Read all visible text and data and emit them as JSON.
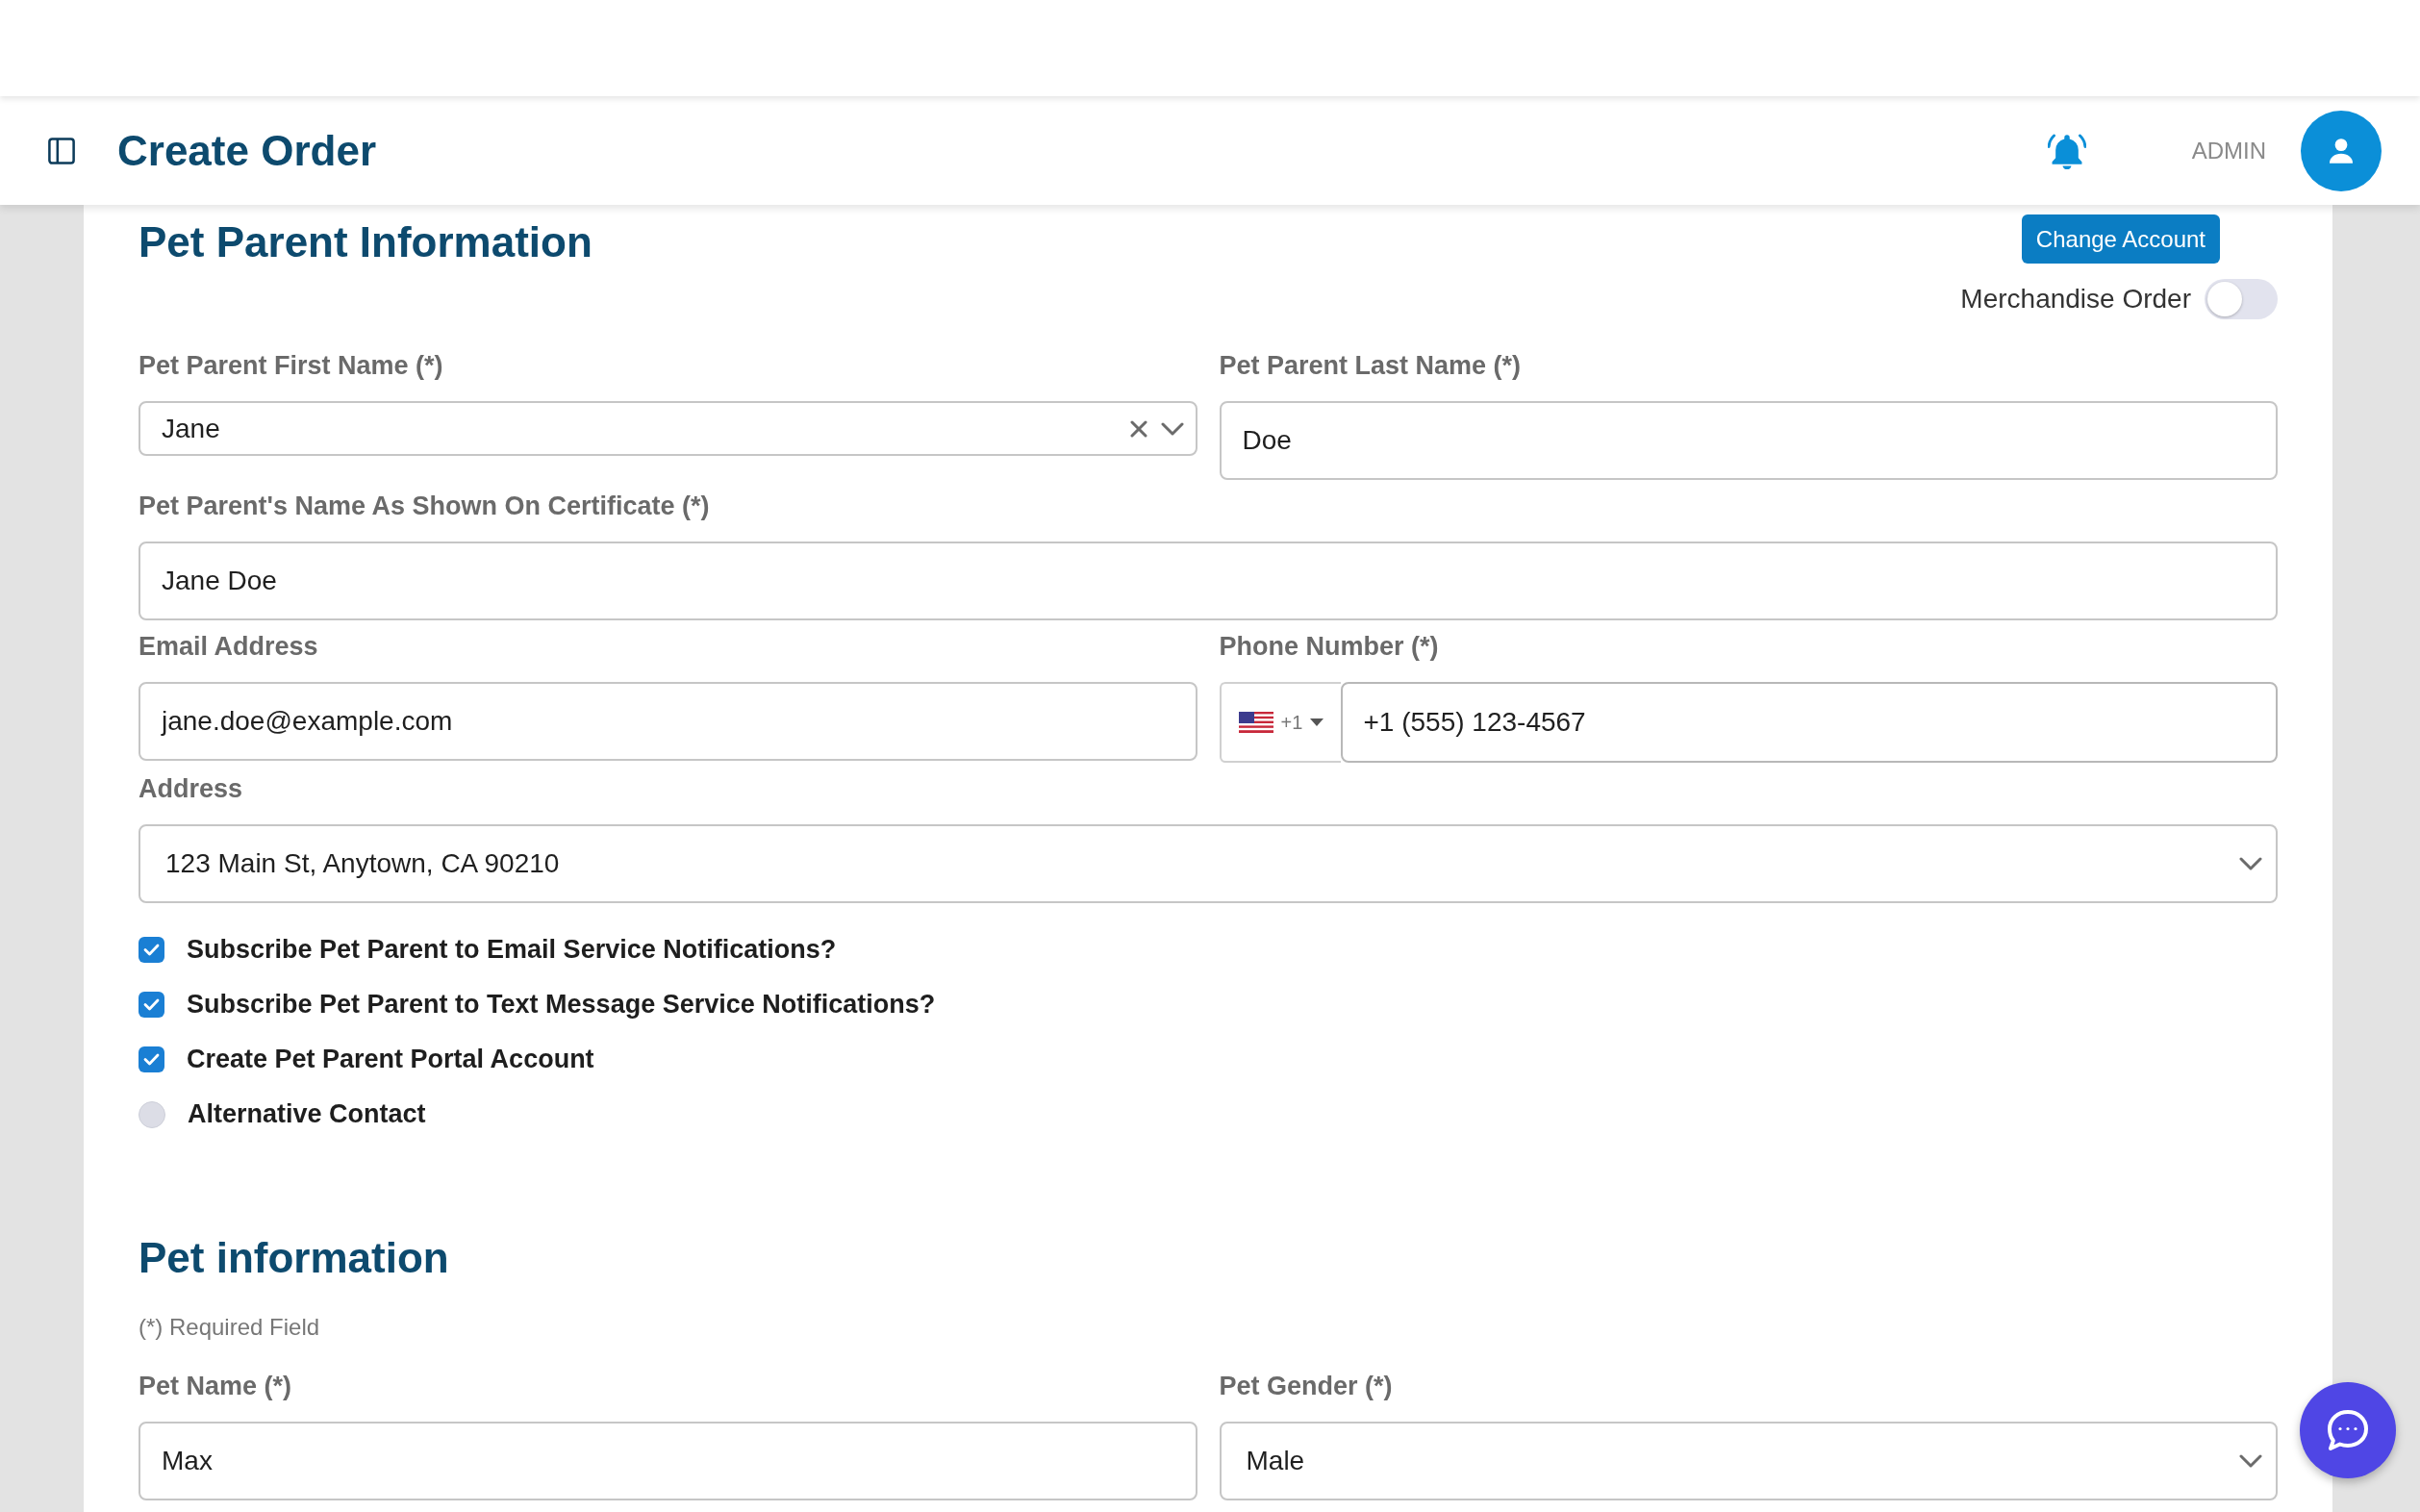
{
  "header": {
    "title": "Create Order",
    "user": "ADMIN"
  },
  "pet_parent": {
    "title": "Pet Parent Information",
    "change_account": "Change Account",
    "merchandise_order": {
      "label": "Merchandise Order",
      "on": false
    },
    "rows": [
      [
        {
          "kind": "combo",
          "label": "Pet Parent First Name (*)",
          "value": "Jane"
        },
        {
          "kind": "text",
          "label": "Pet Parent Last Name (*)",
          "value": "Doe"
        }
      ],
      [
        {
          "kind": "text",
          "label": "Pet Parent's Name As Shown On Certificate (*)",
          "value": "Jane Doe"
        }
      ],
      [
        {
          "kind": "text",
          "label": "Email Address",
          "value": "jane.doe@example.com"
        },
        {
          "kind": "phone",
          "label": "Phone Number (*)",
          "country_code": "+1",
          "value": "+1 (555) 123-4567"
        }
      ],
      [
        {
          "kind": "select",
          "label": "Address",
          "value": "123 Main St, Anytown, CA 90210"
        }
      ]
    ],
    "options": [
      {
        "label": "Subscribe Pet Parent to Email Service Notifications?",
        "checked": true
      },
      {
        "label": "Subscribe Pet Parent to Text Message Service Notifications?",
        "checked": true
      },
      {
        "label": "Create Pet Parent Portal Account",
        "checked": true
      },
      {
        "label": "Alternative Contact",
        "checked": false
      }
    ]
  },
  "pet": {
    "title": "Pet information",
    "note": "(*) Required Field",
    "rows": [
      [
        {
          "kind": "text",
          "label": "Pet Name (*)",
          "value": "Max"
        },
        {
          "kind": "select",
          "label": "Pet Gender (*)",
          "value": "Male"
        }
      ]
    ]
  }
}
